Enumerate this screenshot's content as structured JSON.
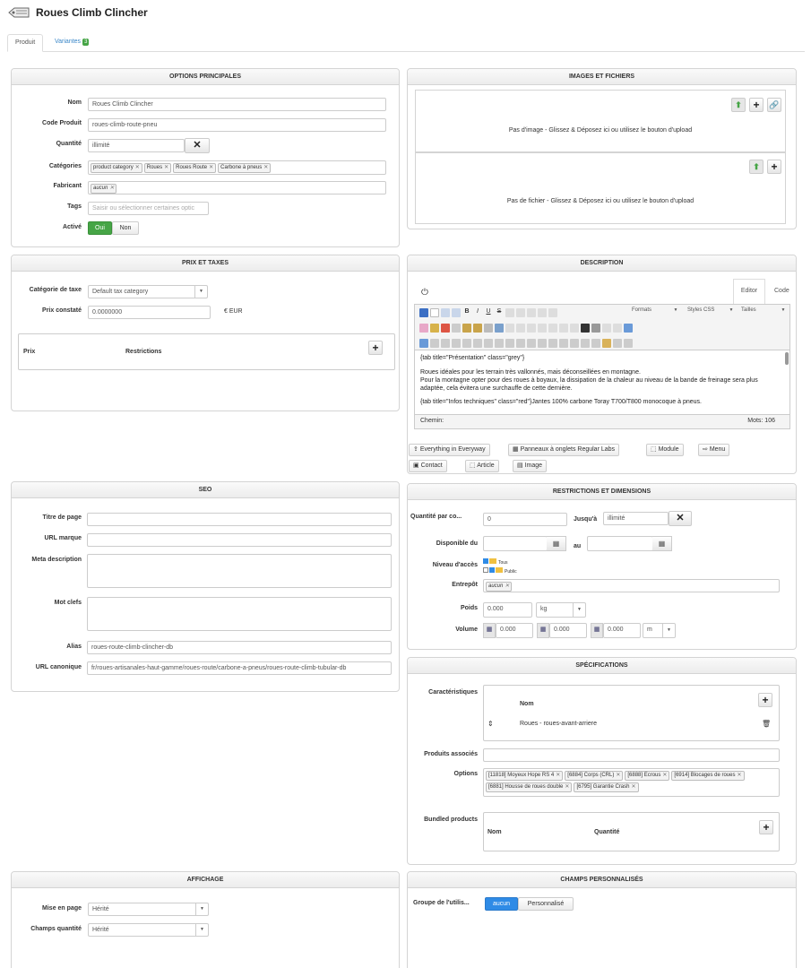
{
  "header": {
    "title": "Roues Climb Clincher",
    "icon": "tag-icon"
  },
  "tabs": [
    {
      "label": "Produit"
    },
    {
      "label": "Variantes",
      "badge": "3"
    }
  ],
  "options_principales": {
    "title": "OPTIONS PRINCIPALES",
    "nom_label": "Nom",
    "nom_value": "Roues Climb Clincher",
    "code_label": "Code Produit",
    "code_value": "roues-climb-route-pneu",
    "qty_label": "Quantité",
    "qty_value": "illimité",
    "cat_label": "Catégories",
    "categories": [
      "product category",
      "Roues",
      "Roues Route",
      "Carbone à pneus"
    ],
    "fab_label": "Fabricant",
    "fabricant": "aucun",
    "tags_label": "Tags",
    "tags_placeholder": "Saisir ou sélectionner certaines optic",
    "active_label": "Activé",
    "oui": "Oui",
    "non": "Non"
  },
  "images": {
    "title": "IMAGES ET FICHIERS",
    "image_drop": "Pas d'image - Glissez & Déposez ici ou utilisez le bouton d'upload",
    "file_drop": "Pas de fichier - Glissez & Déposez ici ou utilisez le bouton d'upload"
  },
  "prix": {
    "title": "PRIX ET TAXES",
    "tax_label": "Catégorie de taxe",
    "tax_value": "Default tax category",
    "prix_label": "Prix constaté",
    "prix_value": "0.0000000",
    "currency": "€ EUR",
    "col_prix": "Prix",
    "col_restrictions": "Restrictions"
  },
  "description": {
    "title": "DESCRIPTION",
    "tab_editor": "Editor",
    "tab_code": "Code",
    "formats": "Formats",
    "styles": "Styles CSS",
    "tailles": "Tailles",
    "line1": "{tab title=\"Présentation\" class=\"grey\"}",
    "line2": "Roues idéales pour les terrain très vallonnés, mais déconseillées en montagne.",
    "line3": "Pour la montagne opter pour des roues à boyaux, la dissipation de la chaleur au niveau de la bande de freinage sera plus",
    "line4": "adaptée, cela évitera une surchauffe de cette dernière.",
    "line5": "{tab title=\"Infos techniques\" class=\"red\"}Jantes 100% carbone Toray T700/T800 monocoque à pneus.",
    "path_label": "Chemin:",
    "words_label": "Mots: 106",
    "buttons": [
      "Everything in Everyway",
      "Panneaux à onglets Regular Labs",
      "Module",
      "Menu",
      "Contact",
      "Article",
      "Image"
    ]
  },
  "seo": {
    "title": "SEO",
    "titre_label": "Titre de page",
    "url_label": "URL marque",
    "meta_label": "Meta description",
    "mot_label": "Mot clefs",
    "alias_label": "Alias",
    "alias_value": "roues-route-climb-clincher-db",
    "canon_label": "URL canonique",
    "canon_value": "fr/roues-artisanales-haut-gamme/roues-route/carbone-a-pneus/roues-route-climb-tubular-db"
  },
  "restrictions": {
    "title": "RESTRICTIONS ET DIMENSIONS",
    "qty_label": "Quantité par co...",
    "qty_value": "0",
    "jusqua_label": "Jusqu'à",
    "jusqua_value": "illimité",
    "dispo_label": "Disponible du",
    "au_label": "au",
    "acces_label": "Niveau d'accès",
    "tous": "Tous",
    "public": "Public",
    "entrepot_label": "Entrepôt",
    "entrepot": "aucun",
    "poids_label": "Poids",
    "poids_value": "0.000",
    "poids_unit": "kg",
    "volume_label": "Volume",
    "vol1": "0.000",
    "vol2": "0.000",
    "vol3": "0.000",
    "vol_unit": "m"
  },
  "specs": {
    "title": "SPÉCIFICATIONS",
    "carac_label": "Caractéristiques",
    "col_nom": "Nom",
    "row1": "Roues - roues-avant-arriere",
    "assoc_label": "Produits associés",
    "options_label": "Options",
    "options": [
      "[11818] Moyeux Hope RS 4",
      "[6884] Corps (CRL)",
      "[6888] Ecrous",
      "[6914] Blocages de roues",
      "[6881] Housse de roues double",
      "[6795] Garantie Crash"
    ],
    "bundled_label": "Bundled products",
    "col_nom2": "Nom",
    "col_qty": "Quantité"
  },
  "affichage": {
    "title": "AFFICHAGE",
    "mise_label": "Mise en page",
    "mise_value": "Hérité",
    "champs_label": "Champs quantité",
    "champs_value": "Hérité"
  },
  "champs": {
    "title": "CHAMPS PERSONNALISÉS",
    "groupe_label": "Groupe de l'utilis...",
    "aucun": "aucun",
    "perso": "Personnalisé"
  },
  "colors": {
    "accent": "#3a87c8",
    "green": "#46a546",
    "blue": "#2f8be6"
  }
}
